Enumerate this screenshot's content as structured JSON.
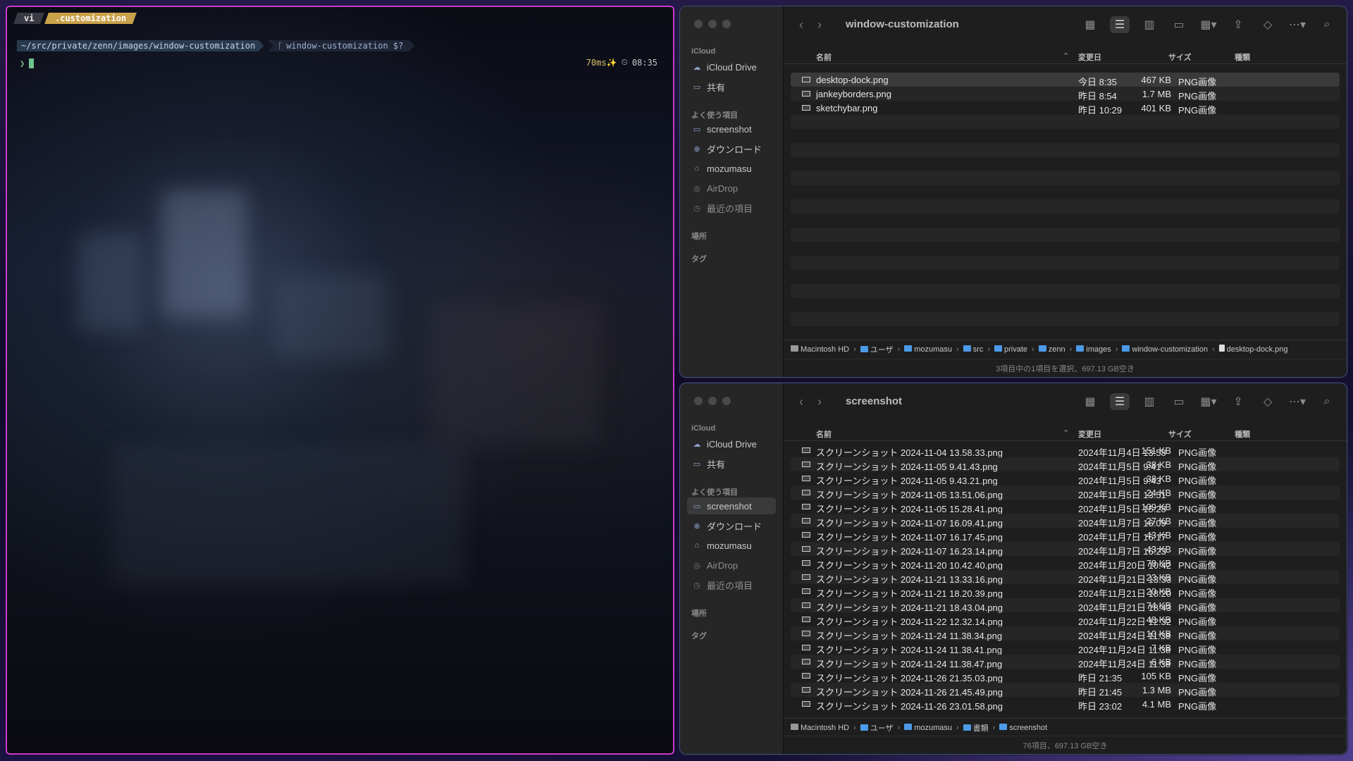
{
  "terminal": {
    "tabs": [
      "vi",
      ".customization"
    ],
    "path": "~/src/private/zenn/images/window-customization",
    "git": "window-customization $?",
    "duration": "70ms✨",
    "time": "08:35",
    "prompt_char": "❯"
  },
  "finder_top": {
    "title": "window-customization",
    "sidebar": {
      "icloud_head": "iCloud",
      "icloud_items": [
        "iCloud Drive",
        "共有"
      ],
      "fav_head": "よく使う項目",
      "fav_items": [
        "screenshot",
        "ダウンロード",
        "mozumasu",
        "AirDrop",
        "最近の項目"
      ],
      "places_head": "場所",
      "tags_head": "タグ"
    },
    "columns": {
      "name": "名前",
      "date": "変更日",
      "size": "サイズ",
      "kind": "種類"
    },
    "rows": [
      {
        "name": "desktop-dock.png",
        "date": "今日 8:35",
        "size": "467 KB",
        "kind": "PNG画像"
      },
      {
        "name": "jankeyborders.png",
        "date": "昨日 8:54",
        "size": "1.7 MB",
        "kind": "PNG画像"
      },
      {
        "name": "sketchybar.png",
        "date": "昨日 10:29",
        "size": "401 KB",
        "kind": "PNG画像"
      }
    ],
    "path": [
      "Macintosh HD",
      "ユーザ",
      "mozumasu",
      "src",
      "private",
      "zenn",
      "images",
      "window-customization",
      "desktop-dock.png"
    ],
    "status": "3項目中の1項目を選択、697.13 GB空き"
  },
  "finder_bottom": {
    "title": "screenshot",
    "sidebar": {
      "icloud_head": "iCloud",
      "icloud_items": [
        "iCloud Drive",
        "共有"
      ],
      "fav_head": "よく使う項目",
      "fav_items": [
        "screenshot",
        "ダウンロード",
        "mozumasu",
        "AirDrop",
        "最近の項目"
      ],
      "places_head": "場所",
      "tags_head": "タグ"
    },
    "columns": {
      "name": "名前",
      "date": "変更日",
      "size": "サイズ",
      "kind": "種類"
    },
    "rows": [
      {
        "name": "スクリーンショット 2024-11-04 13.58.33.png",
        "date": "2024年11月4日 13:58",
        "size": "151 KB",
        "kind": "PNG画像"
      },
      {
        "name": "スクリーンショット 2024-11-05 9.41.43.png",
        "date": "2024年11月5日 9:41",
        "size": "38 KB",
        "kind": "PNG画像"
      },
      {
        "name": "スクリーンショット 2024-11-05 9.43.21.png",
        "date": "2024年11月5日 9:43",
        "size": "38 KB",
        "kind": "PNG画像"
      },
      {
        "name": "スクリーンショット 2024-11-05 13.51.06.png",
        "date": "2024年11月5日 13:51",
        "size": "24 KB",
        "kind": "PNG画像"
      },
      {
        "name": "スクリーンショット 2024-11-05 15.28.41.png",
        "date": "2024年11月5日 15:28",
        "size": "109 KB",
        "kind": "PNG画像"
      },
      {
        "name": "スクリーンショット 2024-11-07 16.09.41.png",
        "date": "2024年11月7日 16:09",
        "size": "27 KB",
        "kind": "PNG画像"
      },
      {
        "name": "スクリーンショット 2024-11-07 16.17.45.png",
        "date": "2024年11月7日 16:17",
        "size": "43 KB",
        "kind": "PNG画像"
      },
      {
        "name": "スクリーンショット 2024-11-07 16.23.14.png",
        "date": "2024年11月7日 16:23",
        "size": "43 KB",
        "kind": "PNG画像"
      },
      {
        "name": "スクリーンショット 2024-11-20 10.42.40.png",
        "date": "2024年11月20日 10:42",
        "size": "78 KB",
        "kind": "PNG画像"
      },
      {
        "name": "スクリーンショット 2024-11-21 13.33.16.png",
        "date": "2024年11月21日 13:33",
        "size": "23 KB",
        "kind": "PNG画像"
      },
      {
        "name": "スクリーンショット 2024-11-21 18.20.39.png",
        "date": "2024年11月21日 18:20",
        "size": "20 KB",
        "kind": "PNG画像"
      },
      {
        "name": "スクリーンショット 2024-11-21 18.43.04.png",
        "date": "2024年11月21日 18:43",
        "size": "74 KB",
        "kind": "PNG画像"
      },
      {
        "name": "スクリーンショット 2024-11-22 12.32.14.png",
        "date": "2024年11月22日 12:32",
        "size": "48 KB",
        "kind": "PNG画像"
      },
      {
        "name": "スクリーンショット 2024-11-24 11.38.34.png",
        "date": "2024年11月24日 11:38",
        "size": "10 KB",
        "kind": "PNG画像"
      },
      {
        "name": "スクリーンショット 2024-11-24 11.38.41.png",
        "date": "2024年11月24日 11:38",
        "size": "7 KB",
        "kind": "PNG画像"
      },
      {
        "name": "スクリーンショット 2024-11-24 11.38.47.png",
        "date": "2024年11月24日 11:38",
        "size": "6 KB",
        "kind": "PNG画像"
      },
      {
        "name": "スクリーンショット 2024-11-26 21.35.03.png",
        "date": "昨日 21:35",
        "size": "105 KB",
        "kind": "PNG画像"
      },
      {
        "name": "スクリーンショット 2024-11-26 21.45.49.png",
        "date": "昨日 21:45",
        "size": "1.3 MB",
        "kind": "PNG画像"
      },
      {
        "name": "スクリーンショット 2024-11-26 23.01.58.png",
        "date": "昨日 23:02",
        "size": "4.1 MB",
        "kind": "PNG画像"
      }
    ],
    "path": [
      "Macintosh HD",
      "ユーザ",
      "mozumasu",
      "書類",
      "screenshot"
    ],
    "status": "76項目、697.13 GB空き"
  },
  "colors": {
    "terminal_border": "#c83ac8",
    "finder_border": "#3b4b8a",
    "folder_blue": "#4c9ae8",
    "git_prompt": "#6ec38c"
  }
}
